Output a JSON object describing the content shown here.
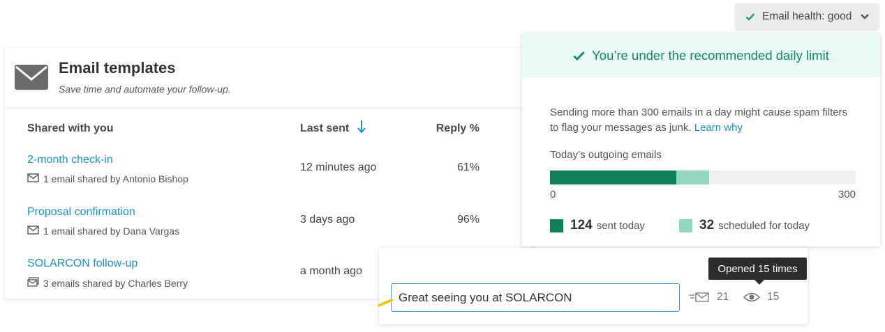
{
  "templates": {
    "title": "Email templates",
    "subtitle": "Save time and automate your follow-up.",
    "columns": {
      "shared": "Shared with you",
      "last_sent": "Last sent",
      "reply": "Reply %"
    },
    "sort_icon": "arrow-down-icon",
    "rows": [
      {
        "title": "2-month check-in",
        "meta": "1 email shared by Antonio Bishop",
        "meta_icon": "envelope-icon",
        "last_sent": "12 minutes ago",
        "reply": "61%"
      },
      {
        "title": "Proposal confirmation",
        "meta": "1 email shared by Dana Vargas",
        "meta_icon": "envelope-icon",
        "last_sent": "3 days ago",
        "reply": "96%"
      },
      {
        "title": "SOLARCON follow-up",
        "meta": "3 emails shared by Charles Berry",
        "meta_icon": "envelopes-icon",
        "last_sent": "a month ago",
        "reply": ""
      }
    ]
  },
  "health": {
    "button_label": "Email health: good",
    "banner": "You’re under the recommended daily limit",
    "warning": "Sending more than 300 emails in a day might cause spam filters to flag your messages as junk.",
    "learn_link": "Learn why",
    "outgoing_label": "Today’s outgoing emails",
    "axis_min": "0",
    "axis_max": "300",
    "limit": 300,
    "sent": 124,
    "scheduled": 32,
    "sent_label": "sent today",
    "scheduled_label": "scheduled for today",
    "sent_value": "124",
    "scheduled_value": "32",
    "colors": {
      "sent": "#10805a",
      "scheduled": "#93d6bf",
      "track": "#f0f0f0",
      "banner_text": "#138a5e"
    }
  },
  "tracking": {
    "subject": "Great seeing you at SOLARCON",
    "tooltip": "Opened 15 times",
    "sends": "21",
    "opens": "15"
  }
}
